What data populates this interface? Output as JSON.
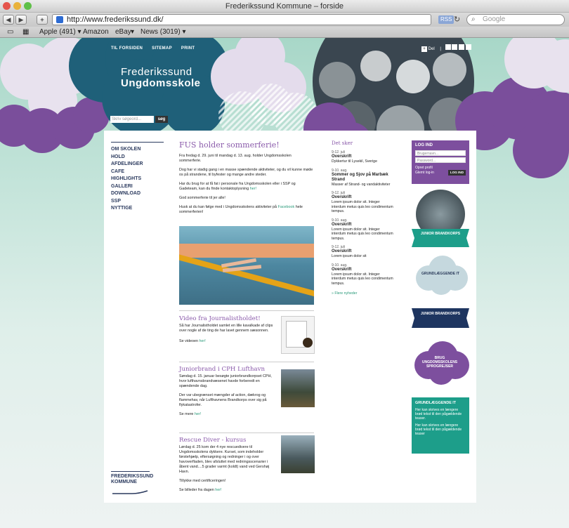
{
  "window": {
    "title": "Frederikssund Kommune – forside"
  },
  "browser": {
    "url": "http://www.frederikssund.dk/",
    "rss": "RSS",
    "search_placeholder": "Google",
    "bookmarks": [
      "Apple (491) ▾",
      "Amazon",
      "eBay",
      "▾",
      "News (3019) ▾"
    ]
  },
  "site": {
    "topnav": [
      "TIL FORSIDEN",
      "SITEMAP",
      "PRINT"
    ],
    "share_label": "Del",
    "logo_line1": "Frederikssund",
    "logo_line2": "Ungdomsskole",
    "search_placeholder": "Skriv søgeord...",
    "search_button": "søg"
  },
  "nav": [
    "OM SKOLEN",
    "HOLD",
    "AFDELINGER",
    "CAFE",
    "HIGHLIGHTS",
    "GALLERI",
    "DOWNLOAD",
    "SSP",
    "NYTTIGE"
  ],
  "kommune": {
    "line1": "FREDERIKSSUND",
    "line2": "KOMMUNE"
  },
  "main": {
    "title": "FUS holder sommerferie!",
    "p1": "Fra fredag d. 29. juni til mandag d. 13. aug. holder Ungdomsskolen sommerferie.",
    "p2": "Dog har vi stadig gang i en masse spændende aktiviteter, og du vil kunne møde os på strandene, til byfester og mange andre steder.",
    "p3": "Har du brug for at få fat i personale fra Ungdomsskolen eller i SSP og Gadeteam, kan du finde kontaktoplysning",
    "p3_link": "her!",
    "p4": "God sommerferie til jer alle!",
    "p5": "Husk at du kan følge med i Ungdomsskolens aktiviteter på",
    "p5_link": "Facebook",
    "p5_end": "hele sommerferien!"
  },
  "articles": [
    {
      "title": "Video fra Journalistholdet!",
      "text": "Så har Journalistholdet samlet en lille kavalkade af clips over nogle af de ting de har lavet gennem sæsonnen.",
      "more": "Se videoen",
      "link": "her!"
    },
    {
      "title": "Juniorbrand i CPH Lufthavn",
      "text": "Søndag d. 15. januar besøgte juniorbrandkorpset CPH, hvor lufthavnsbrandvæsenet havde forberedt en spændende dag.",
      "text2": "Der var ubegrænset mængder af action, dækrog og flammehav, når Lufthavnens Brandkorps over sig på flykatastrofer.",
      "more": "Se mere",
      "link": "her!"
    },
    {
      "title": "Rescue Diver - kursus",
      "text": "Lørdag d. 25 kom der 4 nye rescuedivere til Ungdomsskolens dykkere. Kurset, som indeholder førstehjælp, eftersøgning og redninger i og over havoverfladen, blev afsluttet med redningsscenarier i åbent vand....5 grader varmt (koldt) vand ved Gershøj Havn.",
      "text2": "Tillykke med certificeringen!",
      "more": "Se billeder fra dagen",
      "link": "her!"
    }
  ],
  "events": {
    "title": "Det sker",
    "items": [
      {
        "date": "9-12. juli",
        "title": "Overskrift",
        "text": "Dykkertur til Lysekil, Sverige"
      },
      {
        "date": "9-10. aug.",
        "title": "Sommer og Sjov på Marbæk Strand",
        "text": "Masser af Strand- og vandaktiviteter"
      },
      {
        "date": "9-12. juli",
        "title": "Overskrift",
        "text": "Lorem ipsum dolor sit. Integer interdum metus quis leo condimentum tempus."
      },
      {
        "date": "9-10. aug.",
        "title": "Overskrift",
        "text": "Lorem ipsum dolor sit. Integer interdum metus quis leo condimentum tempus."
      },
      {
        "date": "9-12. juli",
        "title": "Overskrift",
        "text": "Lorem ipsum dolor sit"
      },
      {
        "date": "9-10. aug.",
        "title": "Overskrift",
        "text": "Lorem ipsum dolor sit. Integer interdum metus quis leo condimentum tempus."
      }
    ],
    "more": "» Flere nyheder"
  },
  "login": {
    "title": "LOG IND",
    "user_placeholder": "Brugernavn...",
    "pass_placeholder": "Password...",
    "create": "Opret profil",
    "forgot": "Glemt log-in",
    "button": "LOG IND"
  },
  "sidebar": {
    "junior1": "JUNIOR BRANDKORPS",
    "grund": "GRUNDLÆGGENDE IT",
    "junior2": "JUNIOR BRANDKORPS",
    "brug": "BRUG UNGDOMSSKOLENS SPROGREJSER",
    "gi_title": "GRUNDLÆGGENDE IT",
    "gi_t1": "Her kan skrives en længere brød tekst til den pågældende teaser.",
    "gi_t2": "Her kan skrives en længere brød tekst til den pågældende teaser"
  },
  "colors": {
    "purple": "#7d4f9e",
    "teal": "#1d9e8a",
    "navy": "#1e3560",
    "bg": "#a8d7c8"
  }
}
